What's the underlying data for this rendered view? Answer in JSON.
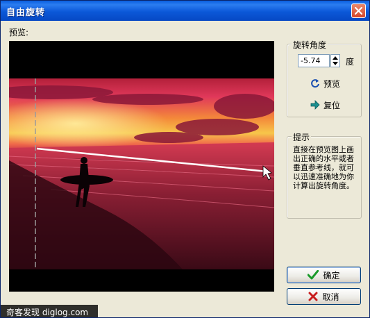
{
  "window": {
    "title": "自由旋转"
  },
  "preview": {
    "label": "预览:"
  },
  "rotation": {
    "group_title": "旋转角度",
    "angle_value": "-5.74",
    "unit": "度",
    "preview_button": "预览",
    "reset_button": "复位"
  },
  "hint": {
    "group_title": "提示",
    "text": "直接在预览图上画出正确的水平或者垂直参考线，就可以迅速准确地为你计算出旋转角度。"
  },
  "buttons": {
    "ok": "确定",
    "cancel": "取消"
  },
  "watermark": {
    "text": "奇客发现 diglog.com"
  },
  "icons": {
    "close": "close-icon",
    "spinner": "spinner-arrows-icon",
    "preview": "rotate-icon",
    "reset": "arrow-right-icon",
    "ok": "checkmark-icon",
    "cancel": "x-icon"
  }
}
